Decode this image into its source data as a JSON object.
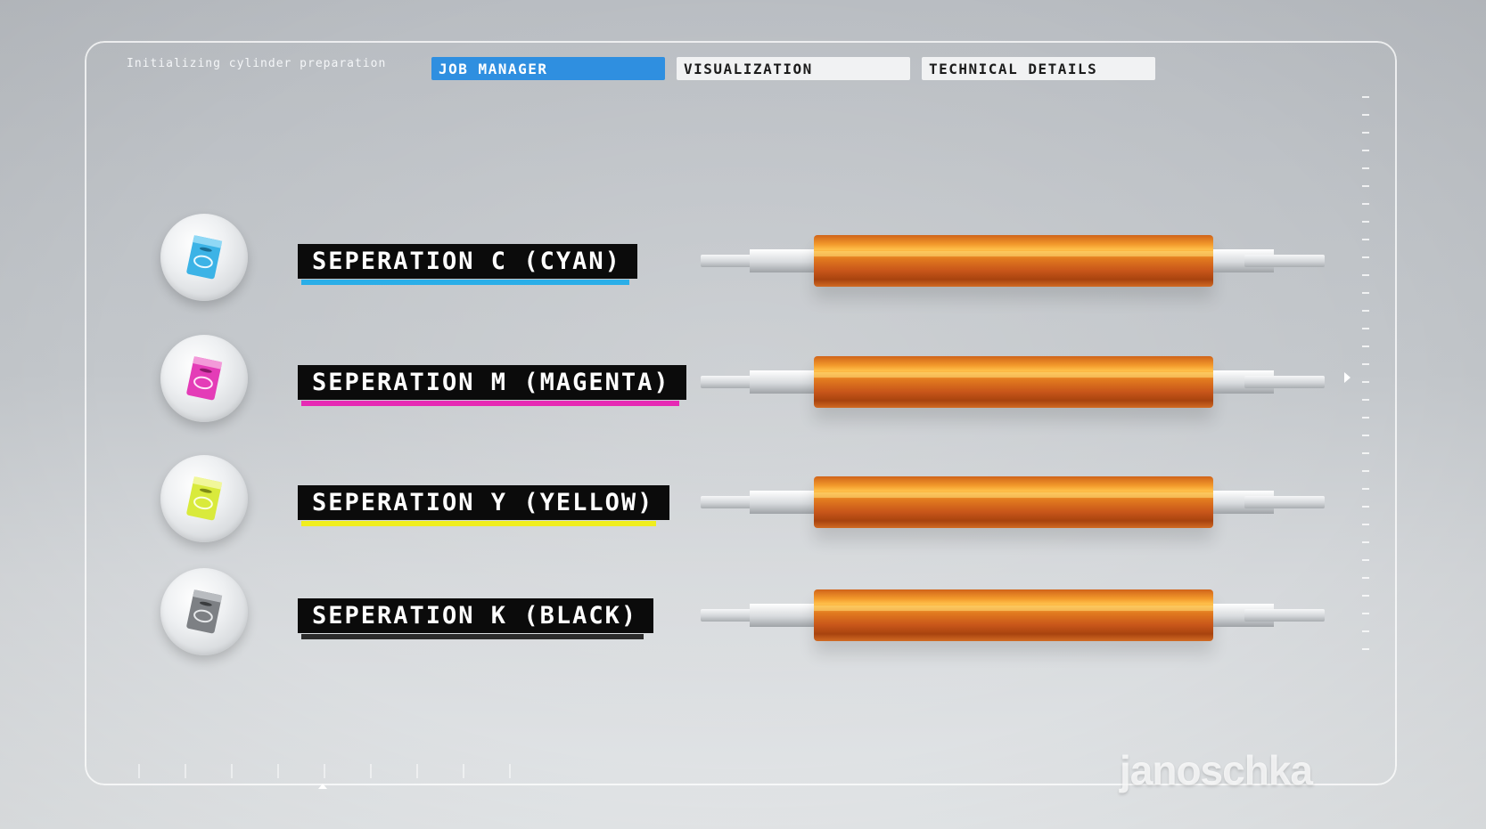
{
  "header": {
    "status_text": "Initializing cylinder preparation",
    "tabs": [
      {
        "label": "JOB MANAGER",
        "active": true
      },
      {
        "label": "VISUALIZATION",
        "active": false
      },
      {
        "label": "TECHNICAL DETAILS",
        "active": false
      }
    ]
  },
  "separations": [
    {
      "label": "SEPERATION C (CYAN)",
      "accent": "#2aaee8",
      "icon": "cyan-ink-packet-icon"
    },
    {
      "label": "SEPERATION M (MAGENTA)",
      "accent": "#e62ab4",
      "icon": "magenta-ink-packet-icon"
    },
    {
      "label": "SEPERATION Y (YELLOW)",
      "accent": "#f0ee1e",
      "icon": "yellow-ink-packet-icon"
    },
    {
      "label": "SEPERATION K (BLACK)",
      "accent": "#2b2b2b",
      "icon": "black-ink-packet-icon"
    }
  ],
  "brand": {
    "logo_text": "janoschka"
  },
  "colors": {
    "tab_active": "#2f8fe0",
    "tab_inactive": "#f1f2f3",
    "cylinder": "#e27b1f"
  }
}
